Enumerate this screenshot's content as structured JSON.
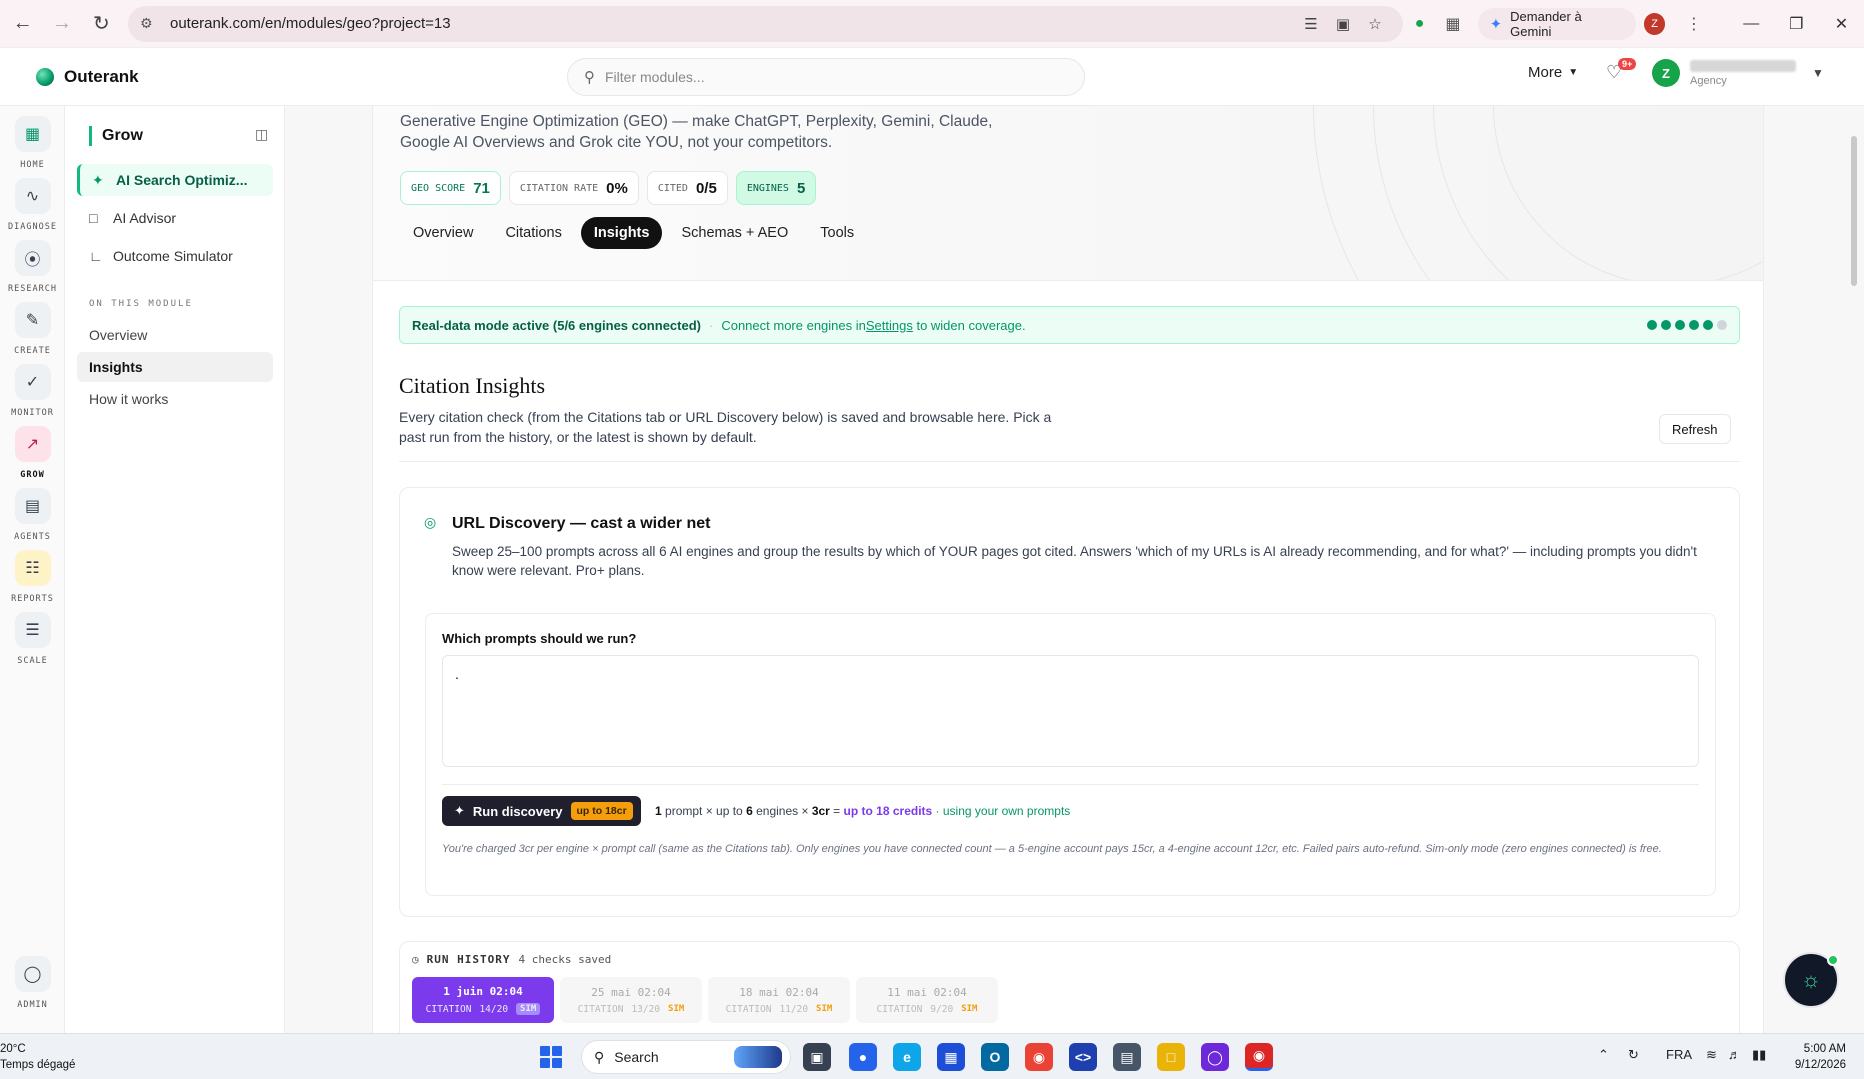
{
  "browser": {
    "url": "outerank.com/en/modules/geo?project=13",
    "gemini_label": "Demander à Gemini",
    "profile_initial": "Z"
  },
  "header": {
    "brand": "Outerank",
    "filter_placeholder": "Filter modules...",
    "more_label": "More",
    "notif_badge": "9+",
    "user_initial": "Z",
    "user_role": "Agency"
  },
  "rail": {
    "items": [
      {
        "label": "HOME",
        "icon": "grid-icon"
      },
      {
        "label": "DIAGNOSE",
        "icon": "pulse-icon"
      },
      {
        "label": "RESEARCH",
        "icon": "compass-icon"
      },
      {
        "label": "CREATE",
        "icon": "pen-icon"
      },
      {
        "label": "MONITOR",
        "icon": "shield-check-icon"
      },
      {
        "label": "GROW",
        "icon": "trend-up-icon"
      },
      {
        "label": "AGENTS",
        "icon": "bot-icon"
      },
      {
        "label": "REPORTS",
        "icon": "report-icon"
      },
      {
        "label": "SCALE",
        "icon": "layers-icon"
      }
    ],
    "admin_label": "ADMIN"
  },
  "sidebar": {
    "title": "Grow",
    "items": [
      {
        "label": "AI Search Optimiz...",
        "icon": "sparkle-wand-icon"
      },
      {
        "label": "AI Advisor",
        "icon": "chat-icon"
      },
      {
        "label": "Outcome Simulator",
        "icon": "chart-icon"
      }
    ],
    "section_label": "ON THIS MODULE",
    "links": [
      "Overview",
      "Insights",
      "How it works"
    ]
  },
  "hero": {
    "description": "Generative Engine Optimization (GEO) — make ChatGPT, Perplexity, Gemini, Claude, Google AI Overviews and Grok cite YOU, not your competitors.",
    "stats": [
      {
        "key": "GEO SCORE",
        "value": "71"
      },
      {
        "key": "CITATION RATE",
        "value": "0%"
      },
      {
        "key": "CITED",
        "value": "0/5"
      },
      {
        "key": "ENGINES",
        "value": "5"
      }
    ],
    "tabs": [
      "Overview",
      "Citations",
      "Insights",
      "Schemas + AEO",
      "Tools"
    ]
  },
  "banner": {
    "strong": "Real-data mode active (5/6 engines connected)",
    "sep": "·",
    "pre": "Connect more engines in ",
    "link": "Settings",
    "post": " to widen coverage.",
    "connected": 5,
    "total": 6
  },
  "insights": {
    "title": "Citation Insights",
    "description": "Every citation check (from the Citations tab or URL Discovery below) is saved and browsable here. Pick a past run from the history, or the latest is shown by default.",
    "refresh_label": "Refresh"
  },
  "discovery": {
    "title": "URL Discovery — cast a wider net",
    "description": "Sweep 25–100 prompts across all 6 AI engines and group the results by which of YOUR pages got cited. Answers 'which of my URLs is AI already recommending, and for what?' — including prompts you didn't know were relevant. Pro+ plans.",
    "prompt_label": "Which prompts should we run?",
    "prompt_value": ".",
    "run_label": "Run discovery",
    "run_chip": "up to 18cr",
    "cost_prompts": "1",
    "cost_t1": " prompt × up to ",
    "cost_engines": "6",
    "cost_t2": " engines × ",
    "cost_cr": "3cr",
    "cost_t3": " = ",
    "cost_total": "up to 18 credits",
    "cost_t4": " · using your own prompts",
    "note": "You're charged 3cr per engine × prompt call (same as the Citations tab). Only engines you have connected count — a 5-engine account pays 15cr, a 4-engine account 12cr, etc. Failed pairs auto-refund. Sim-only mode (zero engines connected) is free."
  },
  "history": {
    "title": "RUN HISTORY",
    "count": "4 checks saved",
    "runs": [
      {
        "date": "1 juin 02:04",
        "label": "CITATION",
        "score": "14/20",
        "tag": "SIM"
      },
      {
        "date": "25 mai 02:04",
        "label": "CITATION",
        "score": "13/20",
        "tag": "SIM"
      },
      {
        "date": "18 mai 02:04",
        "label": "CITATION",
        "score": "11/20",
        "tag": "SIM"
      },
      {
        "date": "11 mai 02:04",
        "label": "CITATION",
        "score": "9/20",
        "tag": "SIM"
      }
    ]
  },
  "taskbar": {
    "weather_temp": "20°C",
    "weather_desc": "Temps dégagé",
    "search_label": "Search",
    "lang": "FRA",
    "time": "5:00 AM",
    "date": "9/12/2026"
  },
  "colors": {
    "accent_green": "#10b981",
    "accent_purple": "#7c3aed",
    "run_button": "#1f1f2e",
    "chip_amber": "#f59e0b"
  }
}
